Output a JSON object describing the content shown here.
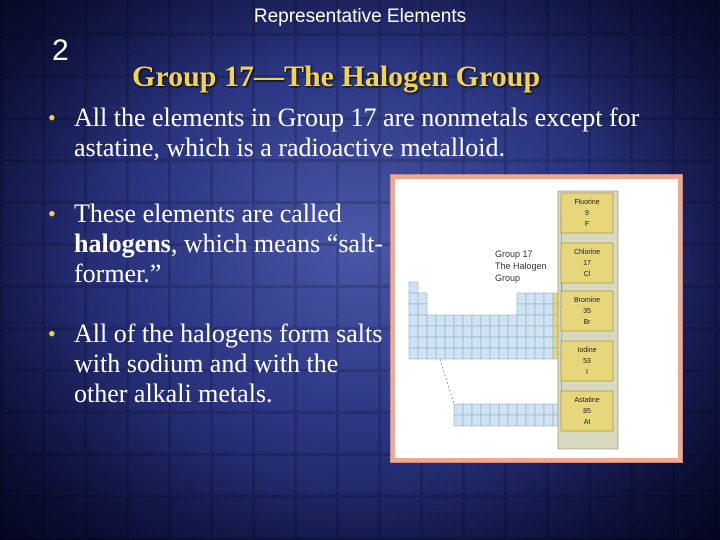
{
  "header": {
    "subtitle": "Representative Elements",
    "slide_number": "2"
  },
  "title": "Group 17—The Halogen Group",
  "bullets": [
    {
      "text": "All the elements in Group 17 are nonmetals except for astatine, which is a radioactive metalloid."
    },
    {
      "pre": "These elements are called ",
      "bold": "halogens",
      "post": ", which means “salt-former.”"
    },
    {
      "text": "All of the halogens form salts with sodium and with the other alkali metals."
    }
  ],
  "figure": {
    "group_label": [
      "Group 17",
      "The Halogen",
      "Group"
    ],
    "elements": [
      {
        "name": "Fluorine",
        "number": "9",
        "symbol": "F"
      },
      {
        "name": "Chlorine",
        "number": "17",
        "symbol": "Cl"
      },
      {
        "name": "Bromine",
        "number": "35",
        "symbol": "Br"
      },
      {
        "name": "Iodine",
        "number": "53",
        "symbol": "I"
      },
      {
        "name": "Astatine",
        "number": "85",
        "symbol": "At"
      }
    ],
    "colors": {
      "halogen": "#e8d77a",
      "table": "#cfe3f2",
      "line": "#8aa6bf",
      "panel": "#d9d9c0"
    }
  }
}
